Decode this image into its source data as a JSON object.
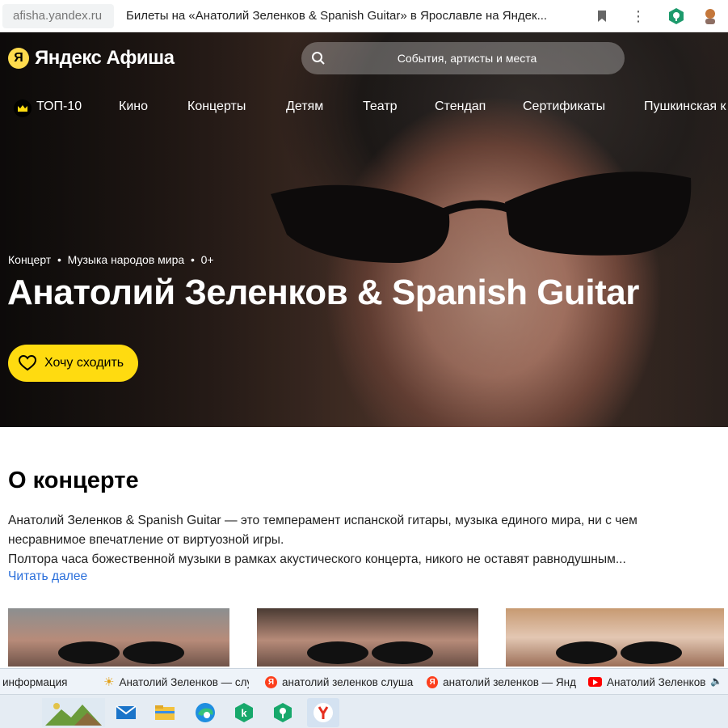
{
  "browser": {
    "url": "afisha.yandex.ru",
    "tab_title": "Билеты на «Анатолий Зеленков & Spanish Guitar» в Ярославле на Яндек..."
  },
  "header": {
    "logo": "Яндекс Афиша",
    "search_placeholder": "События, артисты и места"
  },
  "nav": {
    "items": [
      "ТОП-10",
      "Кино",
      "Концерты",
      "Детям",
      "Театр",
      "Стендап",
      "Сертификаты",
      "Пушкинская к"
    ]
  },
  "event": {
    "tags": "Концерт  •  Музыка народов мира  •  0+",
    "title": "Анатолий Зеленков & Spanish Guitar",
    "want_button": "Хочу сходить"
  },
  "about": {
    "heading": "О концерте",
    "lines": [
      "Анатолий Зеленков & Spanish Guitar — это темперамент испанской гитары, музыка единого мира, ни с чем",
      "несравнимое впечатление от виртуозной игры.",
      "Полтора часа божественной музыки в рамках акустического концерта, никого не оставят равнодушным..."
    ],
    "read_more": "Читать далее"
  },
  "taskbar_tabs": [
    {
      "label": "информация",
      "icon": "none"
    },
    {
      "label": "Анатолий Зеленков — слу",
      "icon": "sun-icon"
    },
    {
      "label": "анатолий зеленков слуша",
      "icon": "yandex-icon"
    },
    {
      "label": "анатолий зеленков — Янд",
      "icon": "yandex-icon"
    },
    {
      "label": "Анатолий Зеленков",
      "icon": "youtube-icon"
    }
  ],
  "colors": {
    "accent_yellow": "#ffdb10",
    "link_blue": "#2a6fdb"
  }
}
